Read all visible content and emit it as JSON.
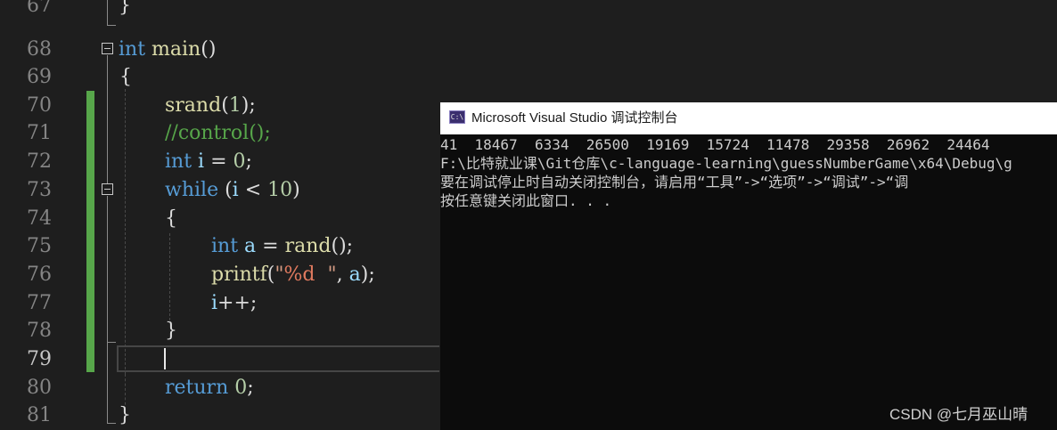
{
  "editor": {
    "line_numbers": [
      "67",
      "68",
      "69",
      "70",
      "71",
      "72",
      "73",
      "74",
      "75",
      "76",
      "77",
      "78",
      "79",
      "80",
      "81"
    ],
    "line68": {
      "kw": "int",
      "fn": "main",
      "rest": "()"
    },
    "line69": {
      "brace": "{"
    },
    "line70": {
      "fn": "srand",
      "open": "(",
      "num": "1",
      "close": ");"
    },
    "line71": {
      "comment": "//control();"
    },
    "line72": {
      "kw": "int",
      "var": "i",
      "eq": " = ",
      "num": "0",
      "semi": ";"
    },
    "line73": {
      "kw": "while",
      "open": " (",
      "var": "i",
      "op": " < ",
      "num": "10",
      "close": ")"
    },
    "line74": {
      "brace": "{"
    },
    "line75": {
      "kw": "int",
      "var": "a",
      "eq": " = ",
      "fn": "rand",
      "rest": "();"
    },
    "line76": {
      "fn": "printf",
      "open": "(",
      "q1": "\"",
      "fmt": "%d",
      "q2": "  \"",
      "comma": ", ",
      "var": "a",
      "close": ");"
    },
    "line77": {
      "var": "i",
      "rest": "++;"
    },
    "line78": {
      "brace": "}"
    },
    "line80": {
      "kw": "return",
      "space": " ",
      "num": "0",
      "semi": ";"
    },
    "line81": {
      "brace": "}"
    },
    "line67": {
      "brace": "}"
    }
  },
  "console": {
    "title": "Microsoft Visual Studio 调试控制台",
    "icon_label": "C:\\",
    "lines": [
      "41  18467  6334  26500  19169  15724  11478  29358  26962  24464",
      "F:\\比特就业课\\Git仓库\\c-language-learning\\guessNumberGame\\x64\\Debug\\g",
      "要在调试停止时自动关闭控制台，请启用“工具”->“选项”->“调试”->“调",
      "按任意键关闭此窗口. . ."
    ]
  },
  "watermark": "CSDN @七月巫山晴",
  "colors": {
    "keyword": "#569cd6",
    "function": "#dcdcaa",
    "variable": "#9cdcfe",
    "number": "#b5cea8",
    "comment": "#57a64a",
    "change_bar": "#57a64a"
  }
}
